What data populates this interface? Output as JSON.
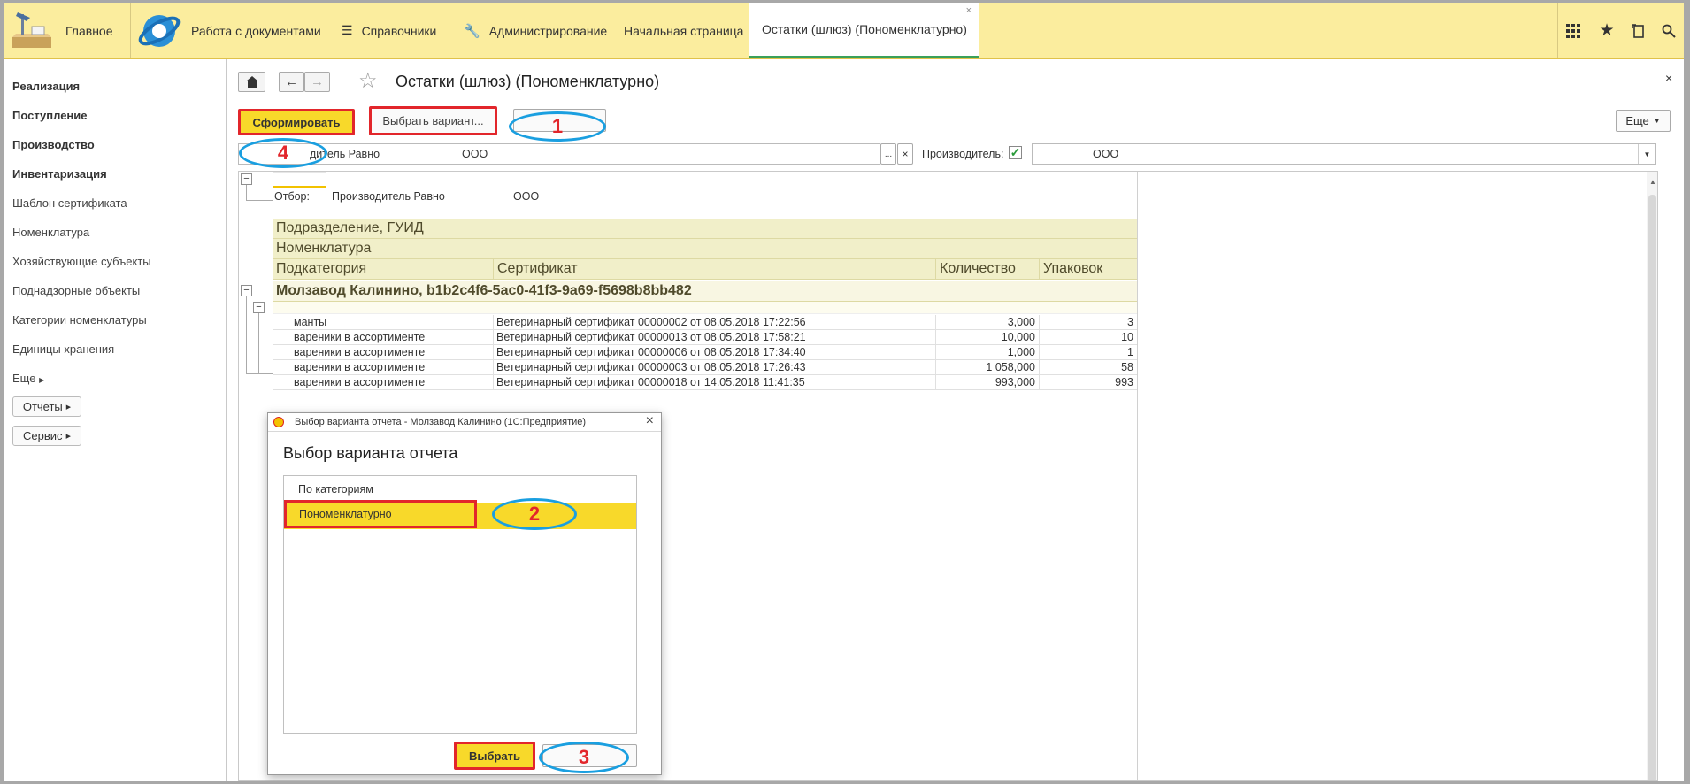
{
  "topbar": {
    "main_label": "Главное",
    "sections": [
      "Работа с документами",
      "Справочники",
      "Администрирование"
    ],
    "tabs": [
      "Начальная страница",
      "Остатки (шлюз) (Пономенклатурно)"
    ],
    "tab_close": "×"
  },
  "sidebar": {
    "items": [
      {
        "label": "Реализация",
        "bold": true
      },
      {
        "label": "Поступление",
        "bold": true
      },
      {
        "label": "Производство",
        "bold": true
      },
      {
        "label": "Инвентаризация",
        "bold": true
      },
      {
        "label": "Шаблон сертификата",
        "bold": false
      },
      {
        "label": "Номенклатура",
        "bold": false
      },
      {
        "label": "Хозяйствующие субъекты",
        "bold": false
      },
      {
        "label": "Поднадзорные объекты",
        "bold": false
      },
      {
        "label": "Категории номенклатуры",
        "bold": false
      },
      {
        "label": "Единицы хранения",
        "bold": false
      },
      {
        "label": "Еще",
        "bold": false
      }
    ],
    "reports_btn": "Отчеты",
    "service_btn": "Сервис"
  },
  "form": {
    "title": "Остатки (шлюз) (Пономенклатурно)",
    "generate_btn": "Сформировать",
    "choose_variant_btn": "Выбрать вариант...",
    "more_btn": "Еще",
    "close": "×",
    "filter_text_label": "дитель Равно",
    "filter_text_value": "ООО",
    "ellipsis": "...",
    "clear": "×",
    "producer_label": "Производитель:",
    "producer_value": "ООО"
  },
  "report": {
    "filter_label": "Отбор:",
    "filter_field": "Производитель Равно",
    "filter_value": "ООО",
    "header_group1": "Подразделение, ГУИД",
    "header_group2": "Номенклатура",
    "columns": [
      "Подкатегория",
      "Сертификат",
      "Количество",
      "Упаковок"
    ],
    "group_row": "Молзавод Калинино, b1b2c4f6-5ac0-41f3-9a69-f5698b8bb482",
    "rows": [
      {
        "sub": "манты",
        "cert": "Ветеринарный сертификат 00000002 от 08.05.2018 17:22:56",
        "qty": "3,000",
        "pk": "3"
      },
      {
        "sub": "вареники в ассортименте",
        "cert": "Ветеринарный сертификат 00000013 от 08.05.2018 17:58:21",
        "qty": "10,000",
        "pk": "10"
      },
      {
        "sub": "вареники в ассортименте",
        "cert": "Ветеринарный сертификат 00000006 от 08.05.2018 17:34:40",
        "qty": "1,000",
        "pk": "1"
      },
      {
        "sub": "вареники в ассортименте",
        "cert": "Ветеринарный сертификат 00000003 от 08.05.2018 17:26:43",
        "qty": "1 058,000",
        "pk": "58"
      },
      {
        "sub": "вареники в ассортименте",
        "cert": "Ветеринарный сертификат 00000018 от 14.05.2018 11:41:35",
        "qty": "993,000",
        "pk": "993"
      }
    ]
  },
  "dialog": {
    "window_title": "Выбор варианта отчета - Молзавод Калинино  (1С:Предприятие)",
    "heading": "Выбор варианта отчета",
    "options": [
      "По категориям",
      "Пономенклатурно"
    ],
    "select_btn": "Выбрать",
    "close": "×"
  },
  "annotations": [
    "1",
    "2",
    "3",
    "4"
  ],
  "colors": {
    "topbar": "#fbed9e",
    "accent_yellow": "#f8d92a",
    "annotation_red": "#e2262b",
    "annotation_blue": "#1a9fe0",
    "active_tab_underline": "#3aa05a"
  }
}
